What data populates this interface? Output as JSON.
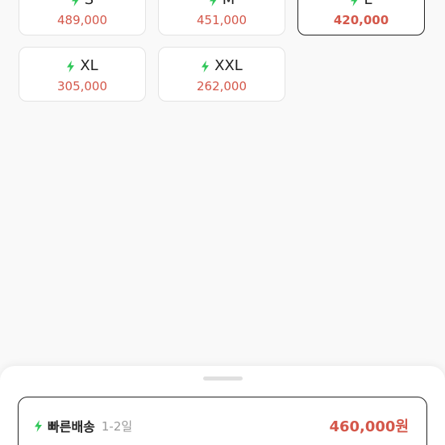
{
  "colors": {
    "accent_green": "#31c75a",
    "price_red": "#d4574a",
    "selected_border": "#222222"
  },
  "sizes": [
    {
      "label": "S",
      "price": "489,000",
      "selected": false
    },
    {
      "label": "M",
      "price": "451,000",
      "selected": false
    },
    {
      "label": "L",
      "price": "420,000",
      "selected": true
    },
    {
      "label": "XL",
      "price": "305,000",
      "selected": false
    },
    {
      "label": "XXL",
      "price": "262,000",
      "selected": false
    }
  ],
  "bottom_sheet": {
    "option": {
      "icon": "lightning-icon",
      "title": "빠른배송",
      "days": "1-2일",
      "price": "460,000원"
    }
  }
}
